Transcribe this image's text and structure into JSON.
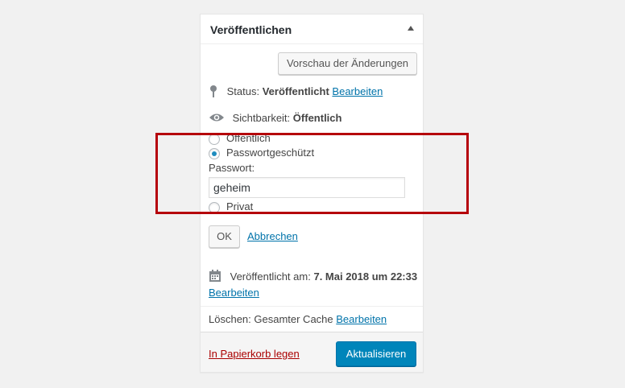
{
  "panel": {
    "title": "Veröffentlichen",
    "preview_button": "Vorschau der Änderungen",
    "status": {
      "label": "Status:",
      "value": "Veröffentlicht",
      "edit": "Bearbeiten"
    },
    "visibility": {
      "label": "Sichtbarkeit:",
      "value": "Öffentlich"
    },
    "visibility_options": [
      {
        "label": "Öffentlich",
        "checked": false
      },
      {
        "label": "Passwortgeschützt",
        "checked": true
      },
      {
        "label": "Privat",
        "checked": false
      }
    ],
    "password_label": "Passwort:",
    "password_value": "geheim",
    "ok_button": "OK",
    "cancel_link": "Abbrechen",
    "published": {
      "label": "Veröffentlicht am:",
      "value": "7. Mai 2018 um 22:33",
      "edit": "Bearbeiten"
    },
    "cache": {
      "label": "Löschen: Gesamter Cache",
      "edit": "Bearbeiten"
    },
    "trash_link": "In Papierkorb legen",
    "update_button": "Aktualisieren"
  },
  "colors": {
    "accent": "#0085ba",
    "link": "#0073aa",
    "delete": "#aa0000",
    "highlight": "#b5000b"
  }
}
